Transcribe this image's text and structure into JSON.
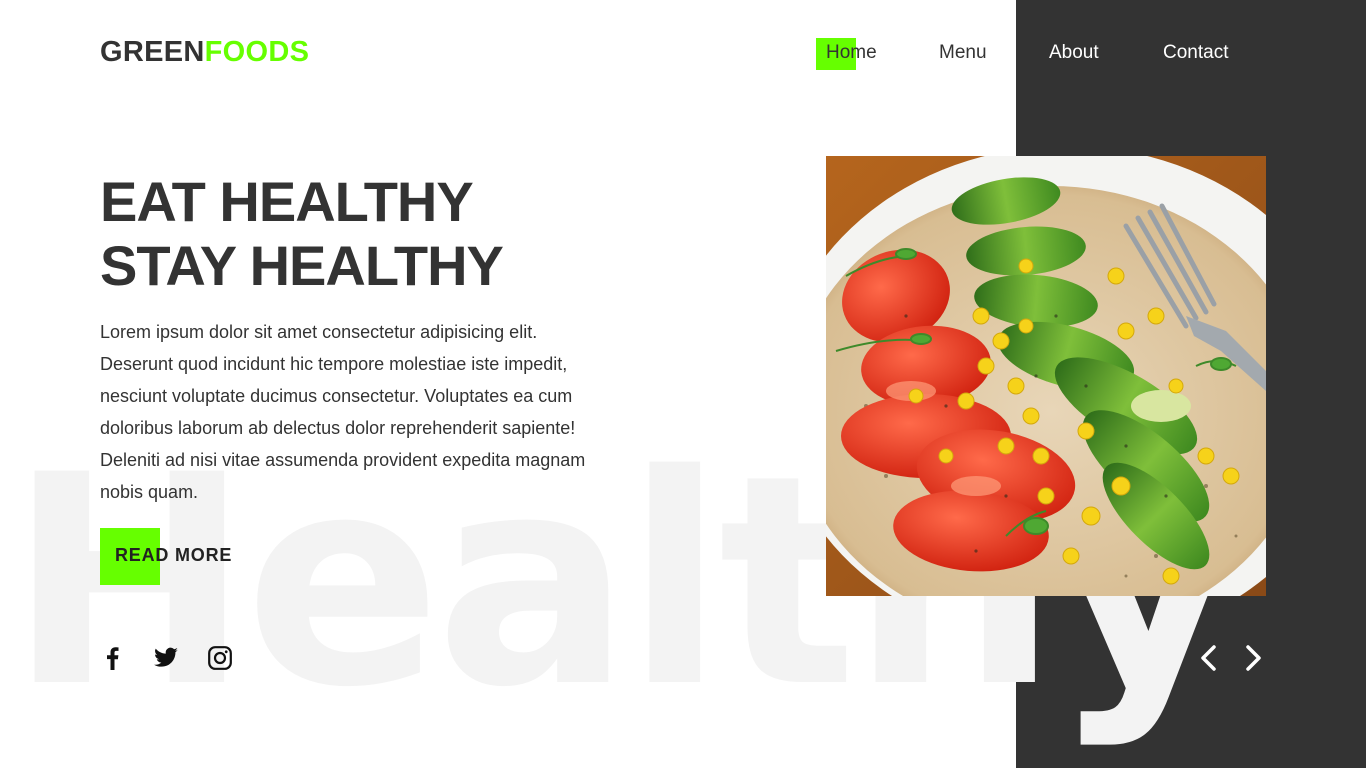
{
  "brand": {
    "part1": "GREEN",
    "part2": "FOODS",
    "accent_color": "#66ff00"
  },
  "nav": {
    "home": "Home",
    "menu": "Menu",
    "about": "About",
    "contact": "Contact"
  },
  "hero": {
    "title_line1": "EAT HEALTHY",
    "title_line2": "STAY HEALTHY",
    "body": "Lorem ipsum dolor sit amet consectetur adipisicing elit. Deserunt quod incidunt hic tempore molestiae iste impedit, nesciunt voluptate ducimus consectetur. Voluptates ea cum doloribus laborum ab delectus dolor reprehenderit sapiente! Deleniti ad nisi vitae assumenda provident expedita magnam nobis quam.",
    "cta": "READ MORE",
    "watermark": "Healthy"
  },
  "social": [
    "facebook-icon",
    "twitter-icon",
    "instagram-icon"
  ],
  "slider": {
    "prev_icon": "chevron-left-icon",
    "next_icon": "chevron-right-icon"
  },
  "colors": {
    "dark_panel": "#333333",
    "accent": "#66ff00",
    "text": "#333333"
  }
}
